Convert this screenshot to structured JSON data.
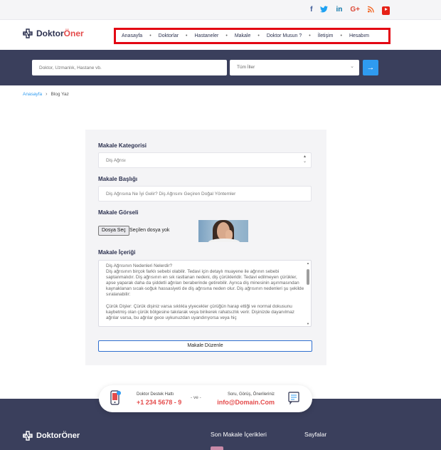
{
  "social": {
    "facebook": "f",
    "twitter": "t",
    "linkedin": "in",
    "googleplus": "G+",
    "rss": "rss",
    "youtube": "youtube"
  },
  "brand": {
    "part1": "Doktor",
    "part2": "Öner",
    "accent": "#e44b4b",
    "navy": "#2d3250"
  },
  "nav": {
    "items": [
      "Anasayfa",
      "Doktorlar",
      "Hastaneler",
      "Makale",
      "Doktor Musun ?",
      "İletişim",
      "Hesabım"
    ],
    "separator": "•",
    "highlight_color": "#e30613"
  },
  "search": {
    "placeholder": "Doktor, Uzmanlık, Hastane vb.",
    "city_value": "Tüm İller",
    "button_color": "#2f9bf0"
  },
  "breadcrumb": {
    "home": "Anasayfa",
    "separator": "›",
    "current": "Blog Yaz"
  },
  "form": {
    "category_label": "Makale Kategorisi",
    "category_value": "Diş Ağrısı",
    "title_label": "Makale Başlığı",
    "title_value": "Diş Ağrısına Ne İyi Gelir? Diş Ağrısını Geçiren Doğal Yöntemler",
    "image_label": "Makale Görseli",
    "file_button": "Dosya Seç",
    "file_status": "Seçilen dosya yok",
    "content_label": "Makale İçeriği",
    "content_paragraphs": [
      "Diş Ağrısının Nedenleri Nelerdir?",
      "Diş ağrısının birçok farklı sebebi olabilir. Tedavi için detaylı muayene ile ağrının sebebi saptanmalıdır. Diş ağrısının en sık rastlanan nedeni, diş çürükleridir. Tedavi edilmeyen çürükler, apse yaparak daha da şiddetli ağrıları beraberinde getirebilir. Ayrıca diş minesinin aşınmasından kaynaklanan sıcak-soğuk hassasiyeti de diş ağrısına neden olur. Diş ağrısının nedenleri şu şekilde sıralanabilir:",
      "Çürük Dişler: Çürük dişiniz varsa sıklıkla yiyecekler çürüğün harap ettiği ve normal dokusunu kaybetmiş olan çürük bölgesine takılarak veya birikerek rahatsızlık verir. Dişinizde dayanılmaz ağrılar varsa, bu ağrılar gece uykunuzdan uyandırıyorsa veya hiç"
    ],
    "submit_label": "Makale Düzenle"
  },
  "support": {
    "line_label": "Doktor Destek Hattı",
    "phone": "+1 234 5678 - 9",
    "connector": "- ve -",
    "feedback_label": "Soru, Görüş, Önerileriniz",
    "email": "info@Domain.Com"
  },
  "footer": {
    "recent_heading": "Son Makale İçerikleri",
    "pages_heading": "Sayfalar"
  }
}
